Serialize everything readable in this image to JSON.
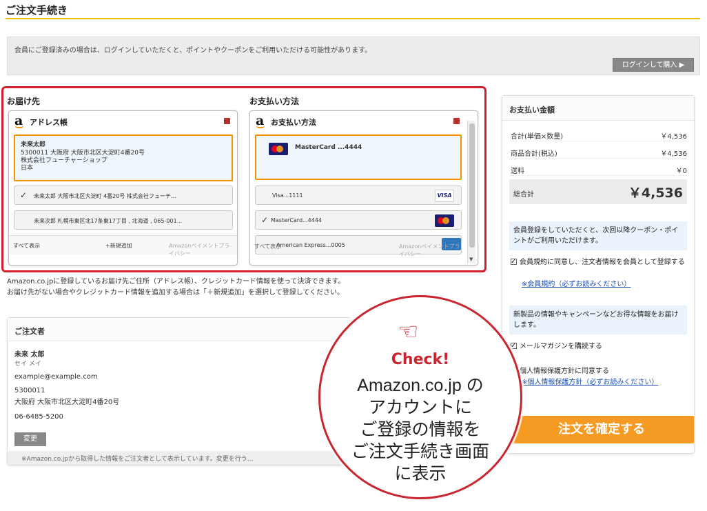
{
  "page": {
    "title": "ご注文手続き"
  },
  "notice": {
    "text": "会員にご登録済みの場合は、ログインしていただくと、ポイントやクーポンをご利用いただける可能性があります。",
    "login_button": "ログインして購入 ▶"
  },
  "shipping": {
    "section_label": "お届け先",
    "widget_title": "アドレス帳",
    "selected": {
      "name": "未来太郎",
      "line1": "5300011 大阪府 大阪市北区大淀町4番20号",
      "line2": "株式会社フューチャーショップ",
      "line3": "日本"
    },
    "options": [
      {
        "check": "✓",
        "text": "未来太郎 大阪市北区大淀町 4番20号 株式会社フューチ..."
      },
      {
        "check": "",
        "text": "未来次郎 札幌市東区北17条東17丁目 , 北海道 , 065-001..."
      }
    ],
    "show_all": "すべて表示",
    "add_new": "+新規追加",
    "policy": "Amazonペイメントプライバシー"
  },
  "payment": {
    "section_label": "お支払い方法",
    "widget_title": "お支払い方法",
    "selected": {
      "icon": "mastercard-icon",
      "text": "MasterCard ...4444"
    },
    "options": [
      {
        "check": "",
        "text": "Visa...1111",
        "icon": "visa-icon",
        "icon_text": "VISA"
      },
      {
        "check": "✓",
        "text": "MasterCard...4444",
        "icon": "mastercard-icon"
      },
      {
        "check": "",
        "text": "American Express...0005",
        "icon": "amex-icon"
      }
    ],
    "show_all": "すべて表示",
    "policy": "Amazonペイメントプライバシー"
  },
  "caption": {
    "line1": "Amazon.co.jpに登録しているお届け先ご住所（アドレス帳）、クレジットカード情報を使って決済できます。",
    "line2": "お届け先がない場合やクレジットカード情報を追加する場合は「＋新規追加」を選択して登録してください。"
  },
  "orderer": {
    "title": "ご注文者",
    "name": "未来 太郎",
    "kana": "セイ メイ",
    "email": "example@example.com",
    "zip": "5300011",
    "address": "大阪府 大阪市北区大淀町4番20号",
    "phone": "06-6485-5200",
    "change_button": "変更",
    "footer_note": "※Amazon.co.jpから取得した情報をご注文者として表示しています。変更を行う..."
  },
  "summary": {
    "title": "お支払い金額",
    "rows": [
      {
        "label": "合計(単価×数量)",
        "value": "￥4,536"
      },
      {
        "label": "商品合計(税込)",
        "value": "￥4,536"
      },
      {
        "label": "送料",
        "value": "￥0"
      }
    ],
    "total_label": "総合計",
    "total_value": "￥4,536",
    "member_info": "会員登録をしていただくと、次回以降クーポン・ポイントがご利用いただけます。",
    "terms_check": "会員規約に同意し、注文者情報を会員として登録する",
    "terms_link": "※会員規約（必ずお読みください）",
    "news_info": "新製品の情報やキャンペーンなどお得な情報をお届けします。",
    "newsletter_check": "メールマガジンを購読する",
    "privacy_check": "個人情報保護方針に同意する",
    "privacy_link": "※個人情報保護方針（必ずお読みください）",
    "confirm_button": "注文を確定する"
  },
  "callout": {
    "check": "Check!",
    "line1": "Amazon.co.jp の",
    "line2": "アカウントに",
    "line3": "ご登録の情報を",
    "line4": "ご注文手続き画面",
    "line5": "に表示"
  },
  "colors": {
    "accent": "#f39200",
    "highlight_red": "#d01e2e",
    "title_rule": "#f0c000"
  }
}
